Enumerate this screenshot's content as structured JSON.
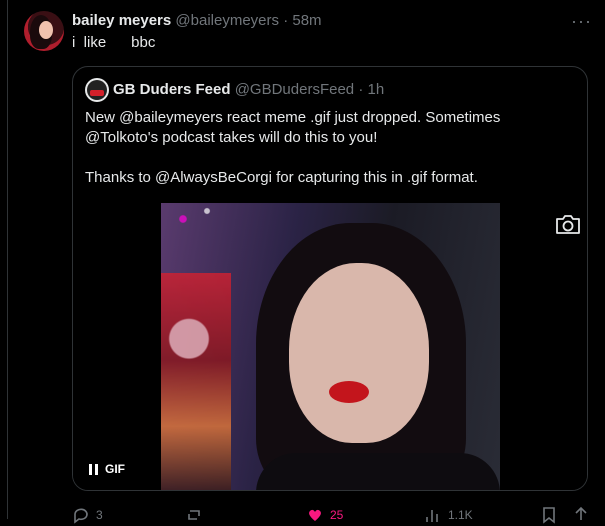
{
  "tweet": {
    "display_name": "bailey meyers",
    "handle": "@baileymeyers",
    "separator": "·",
    "time": "58m",
    "text": "i  like      bbc",
    "more_icon": "more-horizontal-icon"
  },
  "quote": {
    "display_name": "GB Duders Feed",
    "handle": "@GBDudersFeed",
    "separator": "·",
    "time": "1h",
    "lines": [
      "New @baileymeyers react meme .gif just dropped. Sometimes @Tolkoto's podcast takes will do this to you!",
      "Thanks to @AlwaysBeCorgi for capturing this in .gif format."
    ],
    "media": {
      "badge_label": "GIF",
      "pause_icon": "pause-icon",
      "camera_icon": "camera-icon"
    }
  },
  "actions": {
    "reply_count": "3",
    "repost_count": "",
    "like_count": "25",
    "views_count": "1.1K",
    "like_color": "#f91880"
  }
}
